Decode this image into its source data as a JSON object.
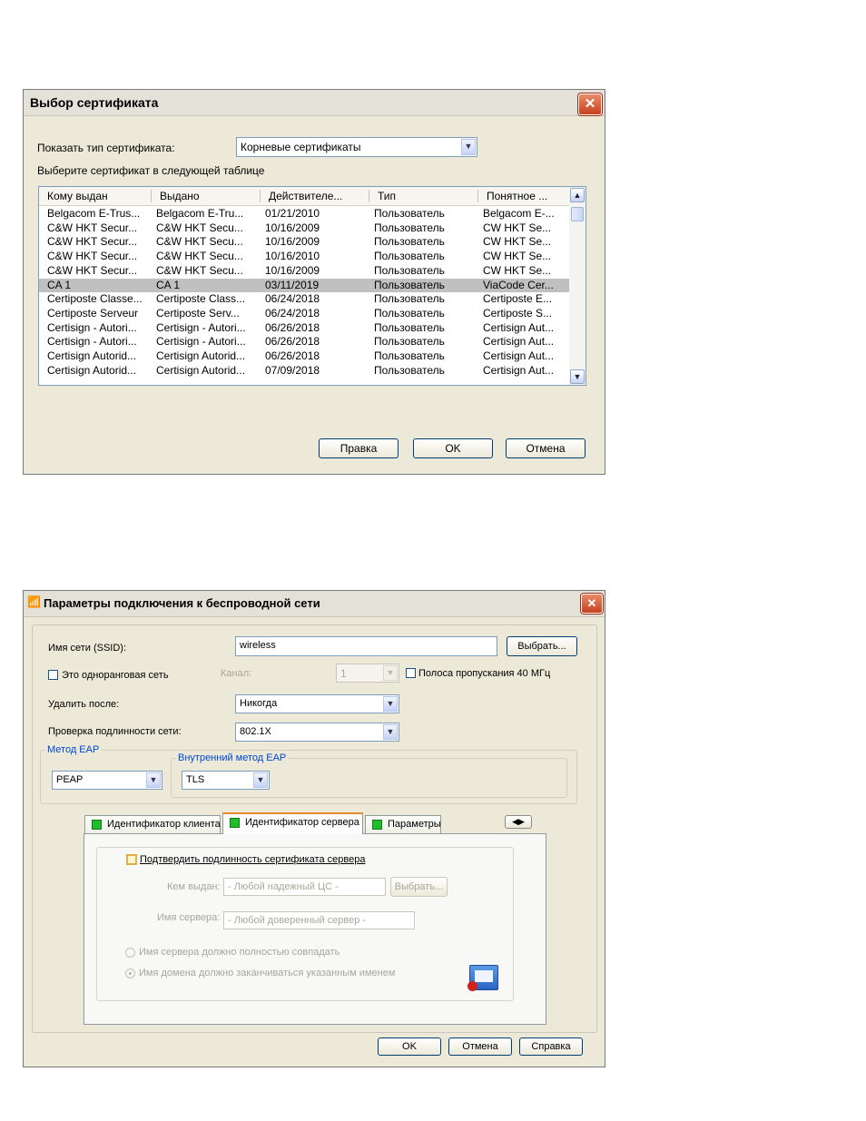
{
  "dialog1": {
    "title": "Выбор сертификата",
    "show_type_label": "Показать тип сертификата:",
    "cert_type_value": "Корневые сертификаты",
    "instruction": "Выберите сертификат в следующей таблице",
    "columns": [
      "Кому выдан",
      "Выдано",
      "Действителе...",
      "Тип",
      "Понятное ..."
    ],
    "rows": [
      [
        "Belgacom E-Trus...",
        "Belgacom E-Tru...",
        "01/21/2010",
        "Пользователь",
        "Belgacom E-..."
      ],
      [
        "C&W HKT Secur...",
        "C&W HKT Secu...",
        "10/16/2009",
        "Пользователь",
        "CW HKT Se..."
      ],
      [
        "C&W HKT Secur...",
        "C&W HKT Secu...",
        "10/16/2009",
        "Пользователь",
        "CW HKT Se..."
      ],
      [
        "C&W HKT Secur...",
        "C&W HKT Secu...",
        "10/16/2010",
        "Пользователь",
        "CW HKT Se..."
      ],
      [
        "C&W HKT Secur...",
        "C&W HKT Secu...",
        "10/16/2009",
        "Пользователь",
        "CW HKT Se..."
      ],
      [
        "CA 1",
        "CA 1",
        "03/11/2019",
        "Пользователь",
        "ViaCode Cer..."
      ],
      [
        "Certiposte Classe...",
        "Certiposte Class...",
        "06/24/2018",
        "Пользователь",
        "Certiposte E..."
      ],
      [
        "Certiposte Serveur",
        "Certiposte Serv...",
        "06/24/2018",
        "Пользователь",
        "Certiposte S..."
      ],
      [
        "Certisign - Autori...",
        "Certisign - Autori...",
        "06/26/2018",
        "Пользователь",
        "Certisign Aut..."
      ],
      [
        "Certisign - Autori...",
        "Certisign - Autori...",
        "06/26/2018",
        "Пользователь",
        "Certisign Aut..."
      ],
      [
        "Certisign Autorid...",
        "Certisign Autorid...",
        "06/26/2018",
        "Пользователь",
        "Certisign Aut..."
      ],
      [
        "Certisign Autorid...",
        "Certisign Autorid...",
        "07/09/2018",
        "Пользователь",
        "Certisign Aut..."
      ]
    ],
    "selected_row": 5,
    "btn_edit": "Правка",
    "btn_ok": "OK",
    "btn_cancel": "Отмена"
  },
  "dialog2": {
    "title": "Параметры подключения к беспроводной сети",
    "ssid_label": "Имя сети (SSID):",
    "ssid_value": "wireless",
    "btn_select": "Выбрать...",
    "adhoc_label": "Это одноранговая сеть",
    "channel_label": "Канал:",
    "channel_value": "1",
    "bandwidth_label": "Полоса пропускания 40 МГц",
    "delete_after_label": "Удалить после:",
    "delete_after_value": "Никогда",
    "auth_label": "Проверка подлинности сети:",
    "auth_value": "802.1X",
    "eap_group_label": "Метод EAP",
    "eap_value": "PEAP",
    "inner_eap_label": "Внутренний метод EAP",
    "inner_eap_value": "TLS",
    "tabs": [
      "Идентификатор клиента",
      "Идентификатор сервера",
      "Параметры"
    ],
    "active_tab": 1,
    "verify_cert_label": "Подтвердить подлинность сертификата сервера",
    "issued_by_label": "Кем выдан:",
    "issued_by_value": "- Любой надежный ЦС -",
    "btn_select2": "Выбрать...",
    "server_name_label": "Имя сервера:",
    "server_name_value": "- Любой доверенный сервер -",
    "radio_exact": "Имя сервера должно полностью совпадать",
    "radio_domain": "Имя домена должно заканчиваться указанным именем",
    "btn_ok": "OK",
    "btn_cancel": "Отмена",
    "btn_help": "Справка"
  }
}
